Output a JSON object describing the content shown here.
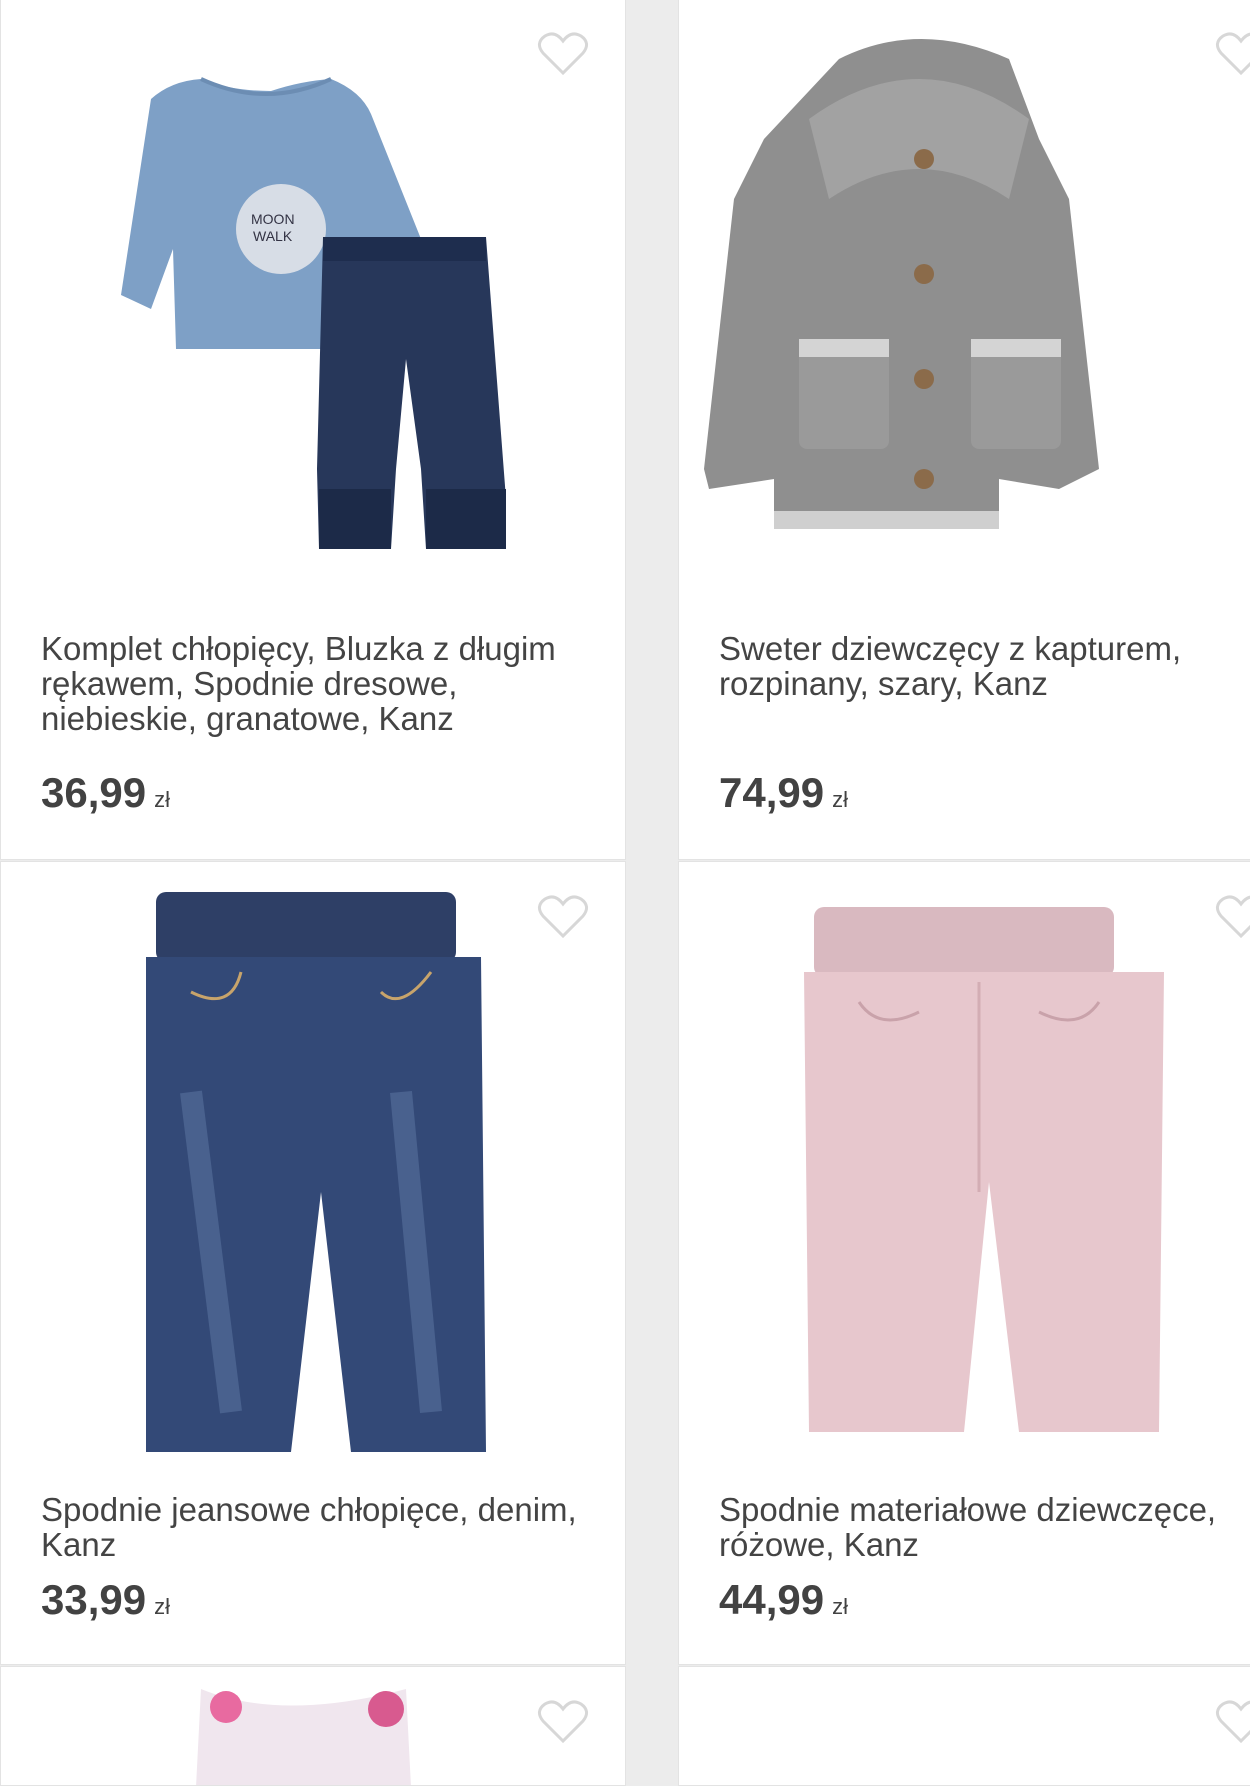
{
  "products": [
    {
      "title": "Komplet chłopięcy, Bluzka z długim rękawem, Spodnie dresowe, niebieskie, granatowe, Kanz",
      "price": "36,99",
      "currency": "zł",
      "image_icon": "outfit-set-image"
    },
    {
      "title": "Sweter dziewczęcy z kapturem, rozpinany, szary, Kanz",
      "price": "74,99",
      "currency": "zł",
      "image_icon": "grey-hooded-cardigan-image"
    },
    {
      "title": "Spodnie jeansowe chłopięce, denim, Kanz",
      "price": "33,99",
      "currency": "zł",
      "image_icon": "denim-jeans-image"
    },
    {
      "title": "Spodnie materiałowe dziewczęce, różowe, Kanz",
      "price": "44,99",
      "currency": "zł",
      "image_icon": "pink-trousers-image"
    }
  ],
  "colors": {
    "heart": "#d7d7d7",
    "text": "#444444",
    "card_border": "#e3e3e3"
  }
}
